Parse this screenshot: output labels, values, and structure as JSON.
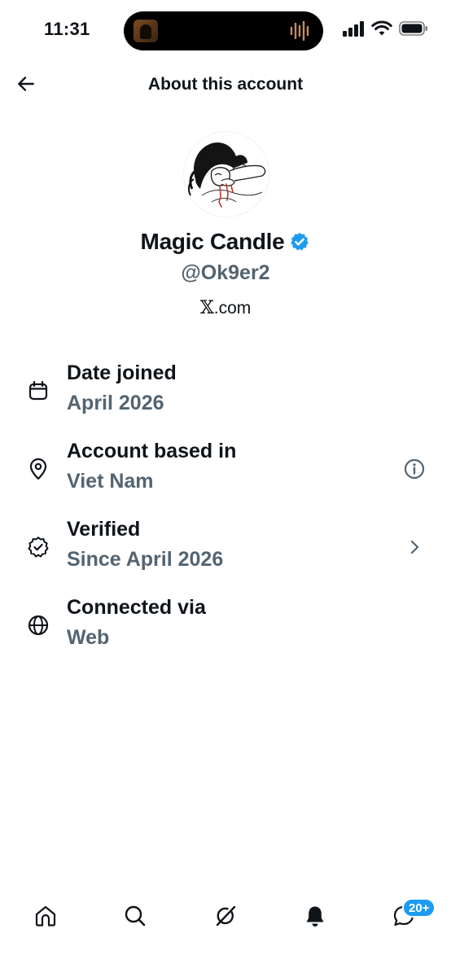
{
  "status_bar": {
    "time": "11:31"
  },
  "header": {
    "title": "About this account"
  },
  "profile": {
    "display_name": "Magic Candle",
    "handle": "@Ok9er2",
    "site": ".com",
    "site_logo_text": "𝕏",
    "verified_color": "#1d9bf0"
  },
  "info": [
    {
      "icon": "calendar-icon",
      "title": "Date joined",
      "value": "April 2026"
    },
    {
      "icon": "location-pin-icon",
      "title": "Account based in",
      "value": "Viet Nam",
      "trailing": "info-icon"
    },
    {
      "icon": "verified-badge-outline-icon",
      "title": "Verified",
      "value": "Since April 2026",
      "trailing": "chevron-right-icon"
    },
    {
      "icon": "globe-icon",
      "title": "Connected via",
      "value": "Web"
    }
  ],
  "tab_bar": {
    "tabs": [
      "home-icon",
      "search-icon",
      "grok-icon",
      "notifications-icon",
      "messages-icon"
    ],
    "messages_badge": "20+"
  },
  "colors": {
    "text_primary": "#0f1419",
    "text_secondary": "#536471",
    "accent": "#1d9bf0"
  }
}
